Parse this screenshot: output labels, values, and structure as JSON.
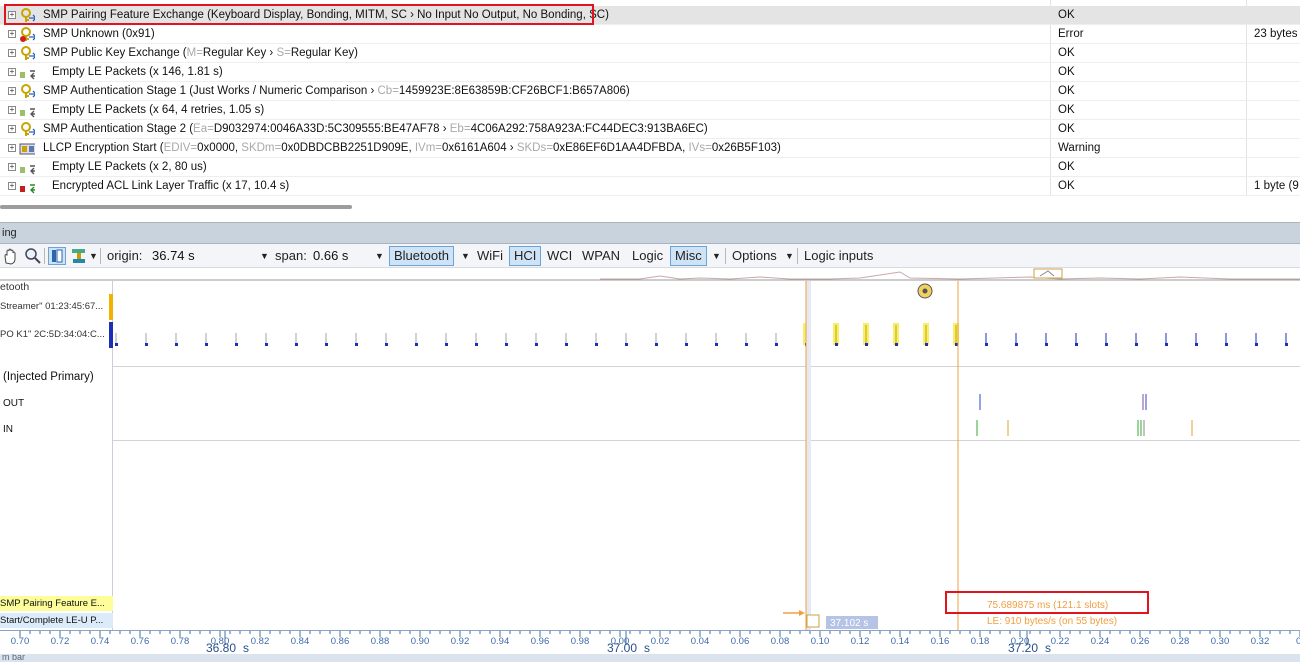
{
  "packet_list": {
    "rows": [
      {
        "name": "SMP Pairing Feature Exchange (Keyboard Display, Bonding, MITM, SC › No Input No Output, No Bonding, SC)",
        "status": "OK",
        "extra": "",
        "icon": "key-icon",
        "selected": true
      },
      {
        "name": "SMP Unknown (0x91)",
        "status": "Error",
        "extra": "23 bytes",
        "icon": "key-error-icon"
      },
      {
        "name_parts": [
          {
            "t": "SMP Public Key Exchange ("
          },
          {
            "t": "M=",
            "g": true
          },
          {
            "t": "Regular Key › "
          },
          {
            "t": "S=",
            "g": true
          },
          {
            "t": "Regular Key)"
          }
        ],
        "status": "OK",
        "extra": "",
        "icon": "key-icon"
      },
      {
        "name": "Empty LE Packets (x 146, 1.81 s)",
        "status": "OK",
        "extra": "",
        "icon": "empty-packets-icon"
      },
      {
        "name_parts": [
          {
            "t": "SMP Authentication Stage 1 (Just Works / Numeric Comparison › "
          },
          {
            "t": "Cb=",
            "g": true
          },
          {
            "t": "1459923E:8E63859B:CF26BCF1:B657A806)"
          }
        ],
        "status": "OK",
        "extra": "",
        "icon": "key-icon"
      },
      {
        "name": "Empty LE Packets (x 64, 4 retries, 1.05 s)",
        "status": "OK",
        "extra": "",
        "icon": "empty-packets-icon"
      },
      {
        "name_parts": [
          {
            "t": "SMP Authentication Stage 2 ("
          },
          {
            "t": "Ea=",
            "g": true
          },
          {
            "t": "D9032974:0046A33D:5C309555:BE47AF78 › "
          },
          {
            "t": "Eb=",
            "g": true
          },
          {
            "t": "4C06A292:758A923A:FC44DEC3:913BA6EC)"
          }
        ],
        "status": "OK",
        "extra": "",
        "icon": "key-icon"
      },
      {
        "name_parts": [
          {
            "t": "LLCP Encryption Start ("
          },
          {
            "t": "EDIV=",
            "g": true
          },
          {
            "t": "0x0000, "
          },
          {
            "t": "SKDm=",
            "g": true
          },
          {
            "t": "0x0DBDCBB2251D909E, "
          },
          {
            "t": "IVm=",
            "g": true
          },
          {
            "t": "0x6161A604 › "
          },
          {
            "t": "SKDs=",
            "g": true
          },
          {
            "t": "0xE86EF6D1AA4DFBDA, "
          },
          {
            "t": "IVs=",
            "g": true
          },
          {
            "t": "0x26B5F103)"
          }
        ],
        "status": "Warning",
        "extra": "",
        "icon": "llcp-icon"
      },
      {
        "name": "Empty LE Packets (x 2, 80 us)",
        "status": "OK",
        "extra": "",
        "icon": "empty-packets-icon"
      },
      {
        "name": "Encrypted ACL Link Layer Traffic  (x 17, 10.4 s)",
        "status": "OK",
        "extra": "1 byte (9",
        "icon": "encrypted-traffic-icon"
      }
    ]
  },
  "timing": {
    "header": "ing",
    "origin_label": "origin:",
    "origin_value": "36.74 s",
    "span_label": "span:",
    "span_value": "0.66 s",
    "tabs": [
      "Bluetooth",
      "WiFi",
      "HCI",
      "WCI",
      "WPAN",
      "Logic",
      "Misc"
    ],
    "active_tabs": [
      "Bluetooth",
      "HCI",
      "Misc"
    ],
    "options_label": "Options",
    "logic_inputs_label": "Logic inputs"
  },
  "lanes": {
    "bt_group": "etooth",
    "device1": "Streamer\" 01:23:45:67...",
    "device2": "PO K1\" 2C:5D:34:04:C...",
    "hci_group": "(Injected Primary)",
    "out": "OUT",
    "in": "IN",
    "bottom1": "SMP Pairing Feature E...",
    "bottom2": "Start/Complete LE-U P..."
  },
  "measurement": {
    "cursor_time": "37.102 s",
    "delta": "75.689875 ms  (121.1 slots)",
    "rate": "LE:  910 bytes/s (on 55 bytes)"
  },
  "axis": {
    "ticks": [
      "0.70",
      "0.72",
      "0.74",
      "0.76",
      "0.78",
      "0.80",
      "0.82",
      "0.84",
      "0.86",
      "0.88",
      "0.90",
      "0.92",
      "0.94",
      "0.96",
      "0.98",
      "0.00",
      "0.02",
      "0.04",
      "0.06",
      "0.08",
      "0.10",
      "0.12",
      "0.14",
      "0.16",
      "0.18",
      "0.20",
      "0.22",
      "0.24",
      "0.26",
      "0.28",
      "0.30",
      "0.32",
      "0."
    ],
    "majors": [
      {
        "label": "36.80",
        "unit": "s"
      },
      {
        "label": "37.00",
        "unit": "s"
      },
      {
        "label": "37.20",
        "unit": "s"
      }
    ]
  },
  "status_bar": "m bar"
}
